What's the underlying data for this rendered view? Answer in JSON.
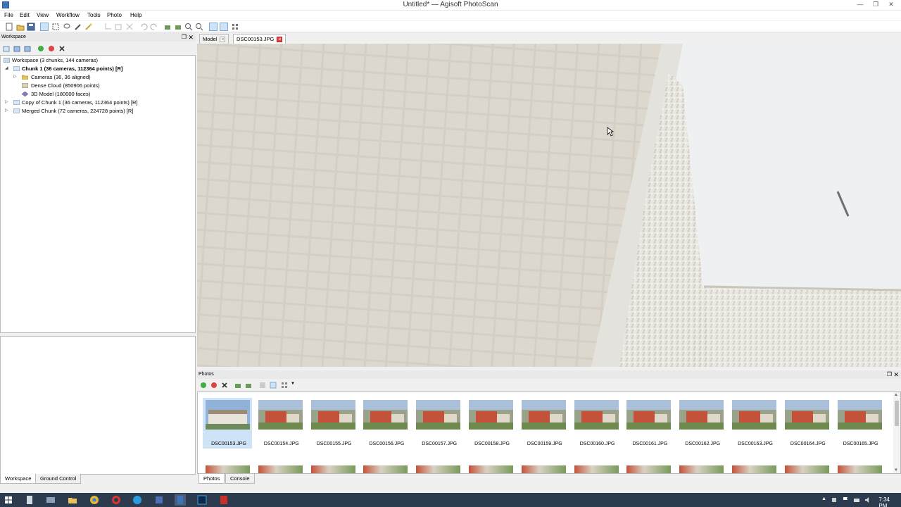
{
  "window": {
    "title": "Untitled* — Agisoft PhotoScan"
  },
  "menu": [
    "File",
    "Edit",
    "View",
    "Workflow",
    "Tools",
    "Photo",
    "Help"
  ],
  "workspace_panel": {
    "title": "Workspace",
    "root": "Workspace (3 chunks, 144 cameras)",
    "chunk1": "Chunk 1 (36 cameras, 112364 points) [R]",
    "cameras": "Cameras (36, 36 aligned)",
    "dense_cloud": "Dense Cloud (850906 points)",
    "model": "3D Model (180000 faces)",
    "copy_chunk": "Copy of Chunk 1 (36 cameras, 112364 points) [R]",
    "merged_chunk": "Merged Chunk (72 cameras, 224728 points) [R]"
  },
  "left_tabs": {
    "workspace": "Workspace",
    "ground_control": "Ground Control"
  },
  "doc_tabs": {
    "model": "Model",
    "photo": "DSC00153.JPG"
  },
  "photos_panel": {
    "title": "Photos",
    "thumbnails": [
      "DSC00153.JPG",
      "DSC00154.JPG",
      "DSC00155.JPG",
      "DSC00156.JPG",
      "DSC00157.JPG",
      "DSC00158.JPG",
      "DSC00159.JPG",
      "DSC00160.JPG",
      "DSC00161.JPG",
      "DSC00162.JPG",
      "DSC00163.JPG",
      "DSC00164.JPG",
      "DSC00165.JPG"
    ],
    "selected": "DSC00153.JPG"
  },
  "bottom_tabs": {
    "photos": "Photos",
    "console": "Console"
  },
  "taskbar": {
    "clock": "7:34 PM"
  },
  "colors": {
    "accent": "#cfe3f7",
    "taskbar": "#2d3b4f",
    "close_red": "#e04343"
  }
}
